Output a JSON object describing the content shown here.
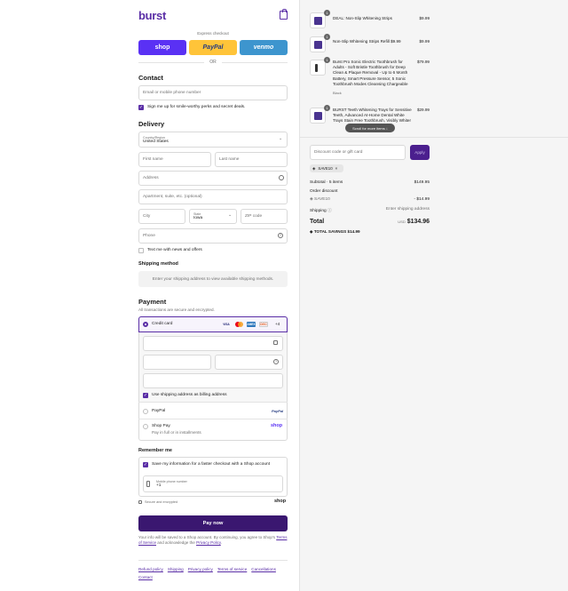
{
  "header": {
    "logo": "burst"
  },
  "express": {
    "label": "Express checkout",
    "shop": "shop",
    "paypal": "PayPal",
    "venmo": "venmo",
    "or": "OR"
  },
  "contact": {
    "title": "Contact",
    "email_placeholder": "Email or mobile phone number",
    "signup_label": "Sign me up for smile-worthy perks and secret deals."
  },
  "delivery": {
    "title": "Delivery",
    "country_label": "Country/Region",
    "country_value": "United States",
    "first_name": "First name",
    "last_name": "Last name",
    "address": "Address",
    "apartment": "Apartment, suite, etc. (optional)",
    "city": "City",
    "state_label": "State",
    "state_value": "Iowa",
    "zip": "ZIP code",
    "phone": "Phone",
    "text_me": "Text me with news and offers"
  },
  "shipping_method": {
    "title": "Shipping method",
    "placeholder": "Enter your shipping address to view available shipping methods."
  },
  "payment": {
    "title": "Payment",
    "subtitle": "All transactions are secure and encrypted.",
    "credit_card": "Credit card",
    "card_brands": [
      "VISA",
      "MC",
      "AMEX",
      "DISC"
    ],
    "more_cards": "+4",
    "billing_label": "Use shipping address as billing address",
    "paypal_label": "PayPal",
    "paypal_logo": "PayPal",
    "shoppay_label": "Shop Pay",
    "shoppay_sub": "Pay in full or in installments",
    "shoppay_logo": "shop"
  },
  "remember": {
    "title": "Remember me",
    "save_label": "Save my information for a faster checkout with a Shop account",
    "mobile_label": "Mobile phone number",
    "mobile_value": "+1",
    "secure": "Secure and encrypted",
    "shop_logo": "shop"
  },
  "pay_now": "Pay now",
  "legal": {
    "text1": "Your info will be saved to a Shop account. By continuing, you agree to Shop's",
    "terms": "Terms of Service",
    "and": " and acknowledge the ",
    "privacy": "Privacy Policy",
    "end": "."
  },
  "footer_links": [
    "Refund policy",
    "Shipping",
    "Privacy policy",
    "Terms of service",
    "Cancellations",
    "Contact"
  ],
  "cart": {
    "items": [
      {
        "qty": "1",
        "name": "DEAL: Non-Slip Whitening Strips",
        "price": "$9.99",
        "variant": ""
      },
      {
        "qty": "1",
        "name": "Non-Slip Whitening Strips Refill $9.99",
        "price": "$9.99",
        "variant": ""
      },
      {
        "qty": "1",
        "name": "Burst Pro Sonic Electric Toothbrush for Adults - Soft Bristle Toothbrush for Deep Clean & Plaque Removal - Up to 6 Month Battery, Smart Pressure Sensor, 5 Sonic Toothbrush Modes Cleansing Chargeable",
        "price": "$79.99",
        "variant": "Black"
      },
      {
        "qty": "1",
        "name": "BURST Teeth Whitening Trays for Sensitive Teeth, Advanced At-Home Dental White Trays Stain Free Toothbrush, Visibly Whiter",
        "price": "$29.99",
        "variant": ""
      }
    ],
    "scroll_hint": "Scroll for more items",
    "discount_placeholder": "Discount code or gift card",
    "apply": "Apply",
    "applied_code": "SAVE10",
    "subtotal_label": "Subtotal · 5 items",
    "subtotal_value": "$149.95",
    "order_discount_label": "Order discount",
    "discount_code": "SAVE10",
    "discount_value": "- $14.99",
    "shipping_label": "Shipping",
    "shipping_value": "Enter shipping address",
    "total_label": "Total",
    "currency": "USD",
    "total_value": "$134.96",
    "savings_label": "TOTAL SAVINGS",
    "savings_value": "$14.99"
  },
  "colors": {
    "brand": "#5a2ea6",
    "pay_button": "#3a1770",
    "shop": "#5a31f4",
    "paypal": "#ffc439",
    "venmo": "#3d95ce"
  }
}
